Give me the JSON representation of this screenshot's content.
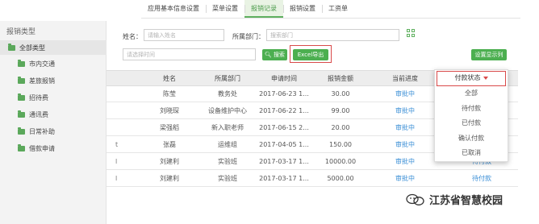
{
  "tabs": [
    {
      "label": "应用基本信息设置"
    },
    {
      "label": "菜单设置"
    },
    {
      "label": "报销记录"
    },
    {
      "label": "报销设置"
    },
    {
      "label": "工资单"
    }
  ],
  "sidebar": {
    "title": "报销类型",
    "all_label": "全部类型",
    "items": [
      {
        "label": "市内交通"
      },
      {
        "label": "差旅报销"
      },
      {
        "label": "招待费"
      },
      {
        "label": "通讯费"
      },
      {
        "label": "日常补助"
      },
      {
        "label": "借款申请"
      }
    ]
  },
  "search": {
    "name_label": "姓名：",
    "name_placeholder": "请输入姓名",
    "dept_label": "所属部门：",
    "dept_placeholder": "搜索部门",
    "time_placeholder": "请选择时间",
    "search_button": "搜索",
    "excel_button": "Excel导出",
    "display_button": "设置显示列"
  },
  "table": {
    "headers": [
      "姓名",
      "所属部门",
      "申请时间",
      "报销金额",
      "当前进度"
    ],
    "rows": [
      {
        "stub": "",
        "name": "陈莹",
        "dept": "教务处",
        "time": "2017-06-23 1...",
        "amount": "30.00",
        "progress": "审批中",
        "pay": ""
      },
      {
        "stub": "",
        "name": "刘晓琛",
        "dept": "设备维护中心",
        "time": "2017-06-22 1...",
        "amount": "99.00",
        "progress": "审批中",
        "pay": ""
      },
      {
        "stub": "",
        "name": "梁强稻",
        "dept": "新入职老师",
        "time": "2017-06-15 2...",
        "amount": "20.00",
        "progress": "审批中",
        "pay": ""
      },
      {
        "stub": "t",
        "name": "张磊",
        "dept": "运维组",
        "time": "2017-04-05 1...",
        "amount": "150.00",
        "progress": "审批中",
        "pay": ""
      },
      {
        "stub": "l",
        "name": "刘建利",
        "dept": "实验班",
        "time": "2017-03-17 1...",
        "amount": "10000.00",
        "progress": "审批中",
        "pay": "待付款"
      },
      {
        "stub": "l",
        "name": "刘建利",
        "dept": "实验班",
        "time": "2017-03-17 1...",
        "amount": "5000.00",
        "progress": "审批中",
        "pay": "待付款"
      }
    ]
  },
  "dropdown": {
    "header": "付款状态",
    "options": [
      "全部",
      "待付款",
      "已付款",
      "确认付款",
      "已取消"
    ]
  },
  "watermark": {
    "text": "江苏省智慧校园"
  },
  "colors": {
    "accent": "#4caf50",
    "highlight": "#d94a4a",
    "link": "#3b8fd6"
  }
}
